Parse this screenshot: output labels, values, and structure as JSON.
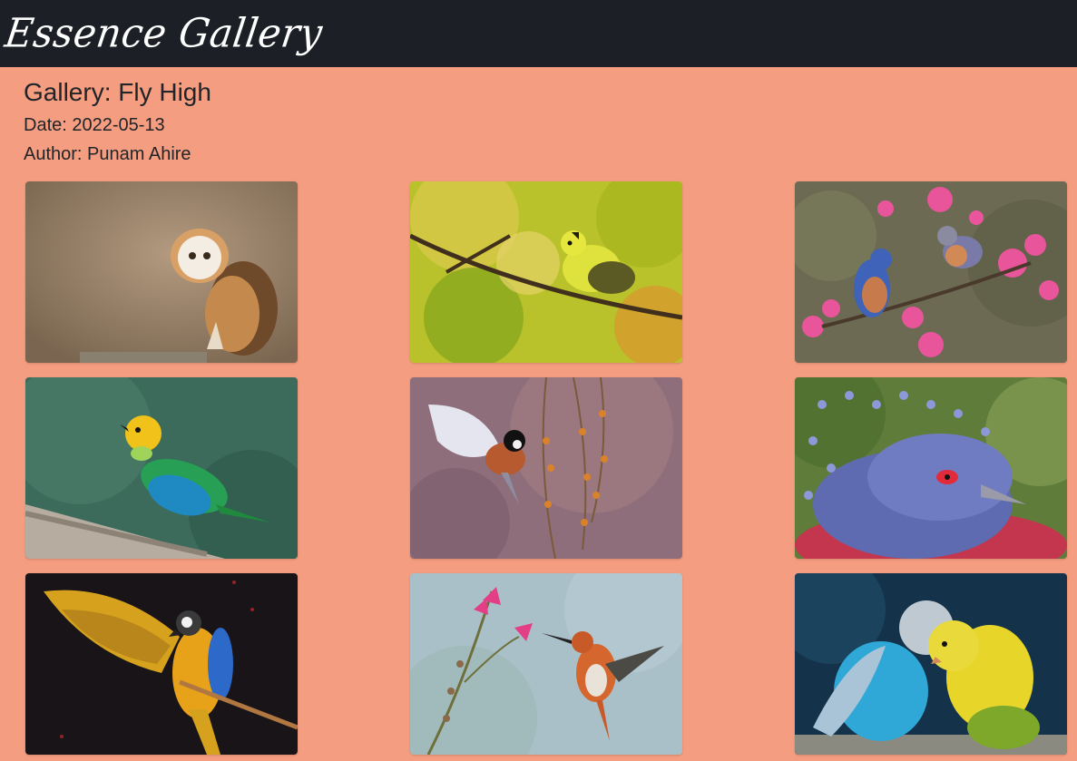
{
  "navbar": {
    "brand": "Essence Gallery"
  },
  "gallery": {
    "title": "Gallery: Fly High",
    "date": "Date: 2022-05-13",
    "author": "Author: Punam Ahire"
  },
  "photos": [
    {
      "subject": "barn-owl"
    },
    {
      "subject": "siskin-on-branch"
    },
    {
      "subject": "bluebirds-blossoms"
    },
    {
      "subject": "green-headed-tanager"
    },
    {
      "subject": "bird-in-flight"
    },
    {
      "subject": "victoria-crowned-pigeon"
    },
    {
      "subject": "macaw-wings-spread"
    },
    {
      "subject": "hummingbird-flower"
    },
    {
      "subject": "budgerigars-pair"
    }
  ]
}
